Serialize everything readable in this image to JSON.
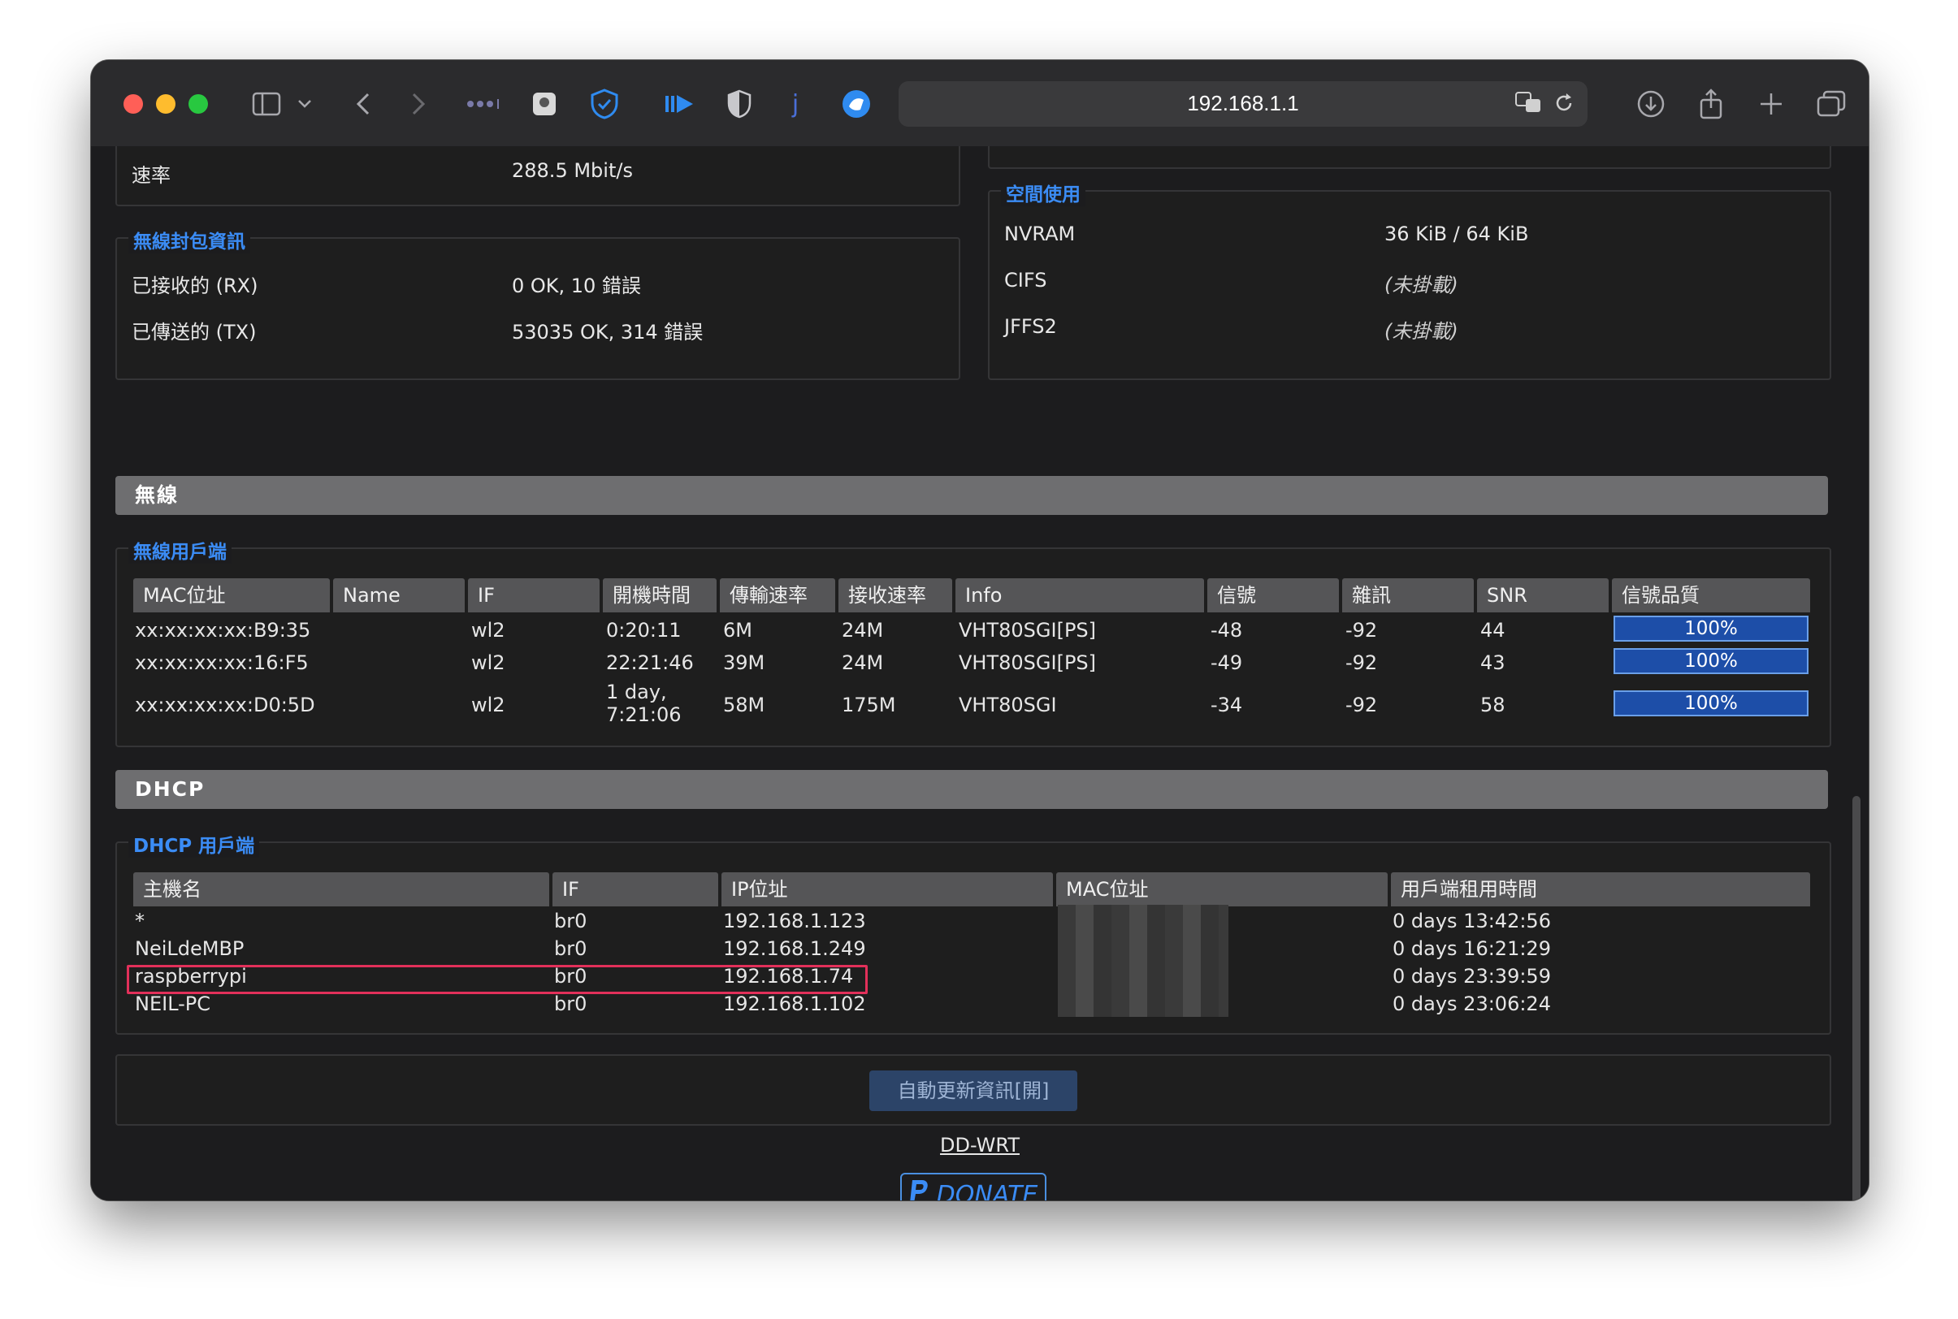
{
  "browser": {
    "url": "192.168.1.1"
  },
  "rate": {
    "label": "速率",
    "value": "288.5 Mbit/s"
  },
  "wireless_packet": {
    "legend": "無線封包資訊",
    "rx_label": "已接收的 (RX)",
    "rx_value": "0 OK, 10 錯誤",
    "tx_label": "已傳送的 (TX)",
    "tx_value": "53035 OK, 314 錯誤"
  },
  "space_usage": {
    "legend": "空間使用",
    "rows": [
      {
        "label": "NVRAM",
        "value": "36 KiB / 64 KiB"
      },
      {
        "label": "CIFS",
        "value": "(未掛載)"
      },
      {
        "label": "JFFS2",
        "value": "(未掛載)"
      }
    ]
  },
  "wireless_section": {
    "title": "無線",
    "clients_legend": "無線用戶端",
    "headers": [
      "MAC位址",
      "Name",
      "IF",
      "開機時間",
      "傳輸速率",
      "接收速率",
      "Info",
      "信號",
      "雜訊",
      "SNR",
      "信號品質"
    ],
    "rows": [
      {
        "mac": "xx:xx:xx:xx:B9:35",
        "name": "",
        "if": "wl2",
        "uptime": "0:20:11",
        "tx": "6M",
        "rx": "24M",
        "info": "VHT80SGI[PS]",
        "signal": "-48",
        "noise": "-92",
        "snr": "44",
        "quality": "100%"
      },
      {
        "mac": "xx:xx:xx:xx:16:F5",
        "name": "",
        "if": "wl2",
        "uptime": "22:21:46",
        "tx": "39M",
        "rx": "24M",
        "info": "VHT80SGI[PS]",
        "signal": "-49",
        "noise": "-92",
        "snr": "43",
        "quality": "100%"
      },
      {
        "mac": "xx:xx:xx:xx:D0:5D",
        "name": "",
        "if": "wl2",
        "uptime": "1 day, 7:21:06",
        "tx": "58M",
        "rx": "175M",
        "info": "VHT80SGI",
        "signal": "-34",
        "noise": "-92",
        "snr": "58",
        "quality": "100%"
      }
    ]
  },
  "dhcp_section": {
    "title": "DHCP",
    "clients_legend": "DHCP 用戶端",
    "headers": [
      "主機名",
      "IF",
      "IP位址",
      "MAC位址",
      "用戶端租用時間"
    ],
    "rows": [
      {
        "host": "*",
        "if": "br0",
        "ip": "192.168.1.123",
        "lease": "0 days 13:42:56"
      },
      {
        "host": "NeiLdeMBP",
        "if": "br0",
        "ip": "192.168.1.249",
        "lease": "0 days 16:21:29"
      },
      {
        "host": "raspberrypi",
        "if": "br0",
        "ip": "192.168.1.74",
        "lease": "0 days 23:39:59"
      },
      {
        "host": "NEIL-PC",
        "if": "br0",
        "ip": "192.168.1.102",
        "lease": "0 days 23:06:24"
      }
    ]
  },
  "footer": {
    "auto_refresh": "自動更新資訊[開]",
    "ddwrt_link": "DD-WRT",
    "donate": "DONATE"
  },
  "colors": {
    "accent_blue": "#3b8cf5",
    "highlight_red": "#e2305a",
    "quality_bar": "#1d4ea8"
  }
}
